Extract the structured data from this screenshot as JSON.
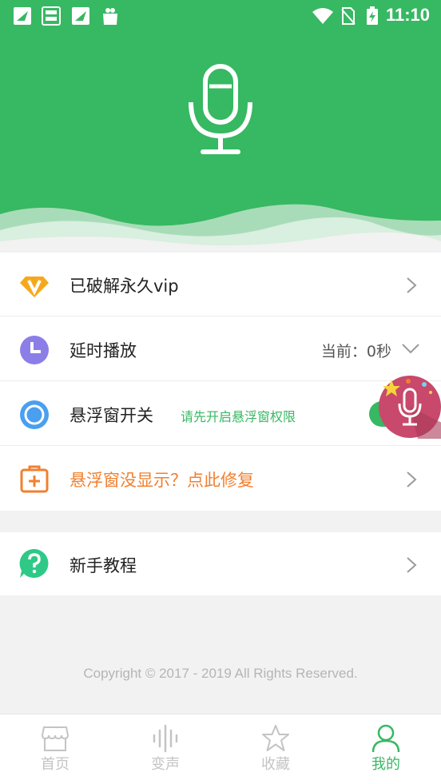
{
  "status_bar": {
    "time": "11:10",
    "left_icons": [
      "app-notification-icon",
      "game-center-icon",
      "app-notification-icon",
      "shopping-bag-icon"
    ],
    "right_icons": [
      "wifi-icon",
      "no-sim-icon",
      "battery-charging-icon"
    ]
  },
  "header": {
    "icon": "microphone-icon",
    "color": "#37b862"
  },
  "menu": {
    "vip": {
      "label": "已破解永久vip",
      "icon": "diamond-v-icon"
    },
    "delay": {
      "label": "延时播放",
      "value": "当前：0秒",
      "icon": "clock-icon"
    },
    "float": {
      "label": "悬浮窗开关",
      "hint": "请先开启悬浮窗权限",
      "icon": "circle-icon"
    },
    "fix": {
      "label": "悬浮窗没显示？点此修复",
      "icon": "medical-kit-icon"
    },
    "tutorial": {
      "label": "新手教程",
      "icon": "question-bubble-icon"
    }
  },
  "copyright": "Copyright © 2017 - 2019 All Rights Reserved.",
  "tabs": [
    {
      "label": "首页",
      "icon": "shop-icon",
      "active": false
    },
    {
      "label": "变声",
      "icon": "sound-wave-icon",
      "active": false
    },
    {
      "label": "收藏",
      "icon": "star-icon",
      "active": false
    },
    {
      "label": "我的",
      "icon": "person-icon",
      "active": true
    }
  ],
  "colors": {
    "accent": "#37b862",
    "orange": "#f08030",
    "vip_gold": "#f6a81c",
    "clock_purple": "#8c7ee8",
    "circle_blue": "#4a9ff0",
    "float_ball": "#c8496b"
  }
}
